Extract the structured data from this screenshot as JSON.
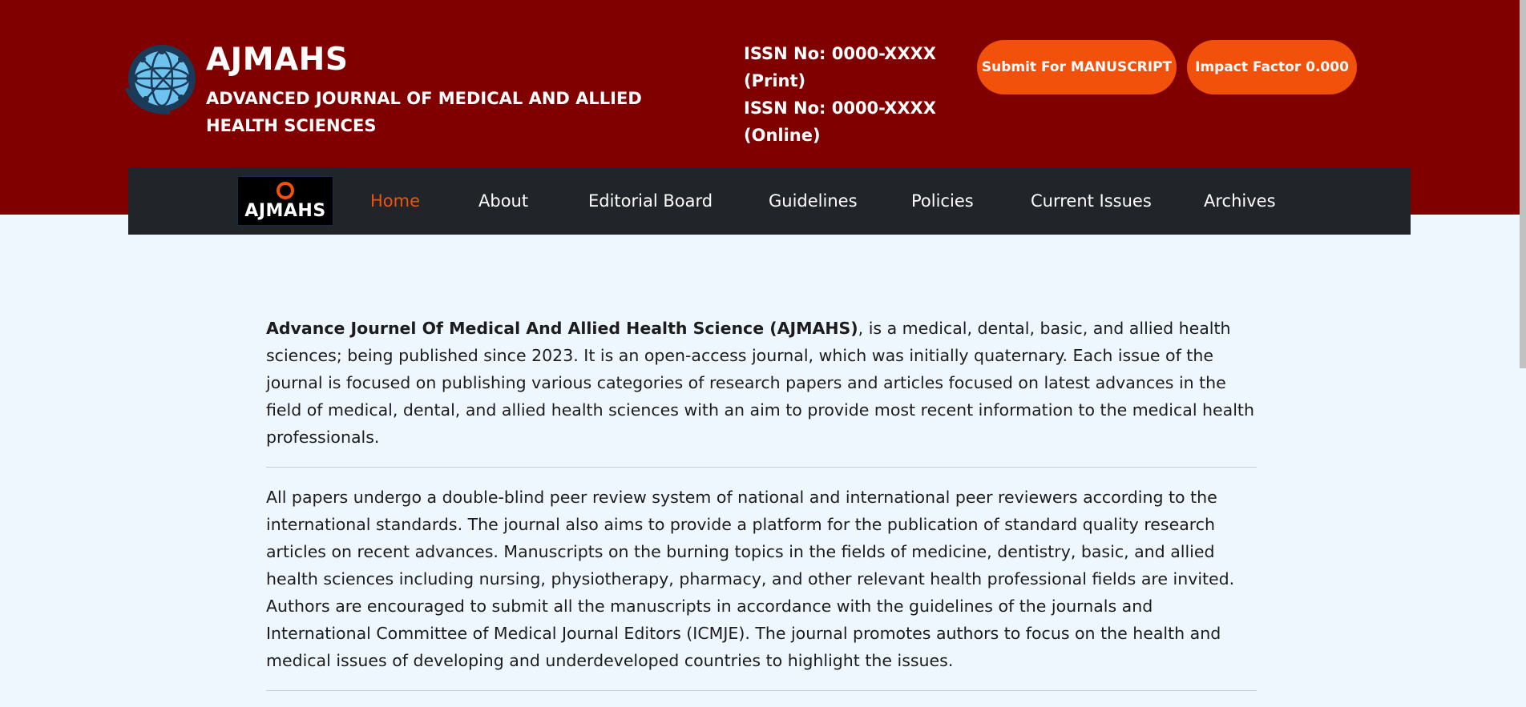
{
  "brand": {
    "title": "AJMAHS",
    "subtitle": "ADVANCED JOURNAL OF MEDICAL AND ALLIED HEALTH SCIENCES"
  },
  "issn": {
    "print": "ISSN No: 0000-XXXX (Print)",
    "online": "ISSN No: 0000-XXXX (Online)"
  },
  "buttons": {
    "submit": "Submit For MANUSCRIPT",
    "impact": "Impact Factor 0.000"
  },
  "nav": {
    "logo_text": "AJMAHS",
    "items": [
      {
        "label": "Home",
        "active": true
      },
      {
        "label": "About"
      },
      {
        "label": "Editorial Board"
      },
      {
        "label": "Guidelines"
      },
      {
        "label": "Policies"
      },
      {
        "label": "Current Issues"
      },
      {
        "label": "Archives"
      }
    ]
  },
  "content": {
    "intro_bold": "Advance Journel Of Medical And Allied Health Science (AJMAHS)",
    "intro_rest": ", is a medical, dental, basic, and allied health sciences; being published since 2023. It is an open-access journal, which was initially quaternary. Each issue of the journal is focused on publishing various categories of research papers and articles focused on latest advances in the field of medical, dental, and allied health sciences with an aim to provide most recent information to the medical health professionals.",
    "second": "All papers undergo a double-blind peer review system of national and international peer reviewers according to the international standards. The journal also aims to provide a platform for the publication of standard quality research articles on recent advances. Manuscripts on the burning topics in the fields of medicine, dentistry, basic, and allied health sciences including nursing, physiotherapy, pharmacy, and other relevant health professional fields are invited. Authors are encouraged to submit all the manuscripts in accordance with the guidelines of the journals and International Committee of Medical Journal Editors (ICMJE). The journal promotes authors to focus on the health and medical issues of developing and underdeveloped countries to highlight the issues."
  },
  "colors": {
    "header": "#800000",
    "accent": "#f2510b",
    "navbar": "#212529",
    "page_bg": "#eff7fe"
  },
  "icons": {
    "logo": "globe-network-icon"
  }
}
